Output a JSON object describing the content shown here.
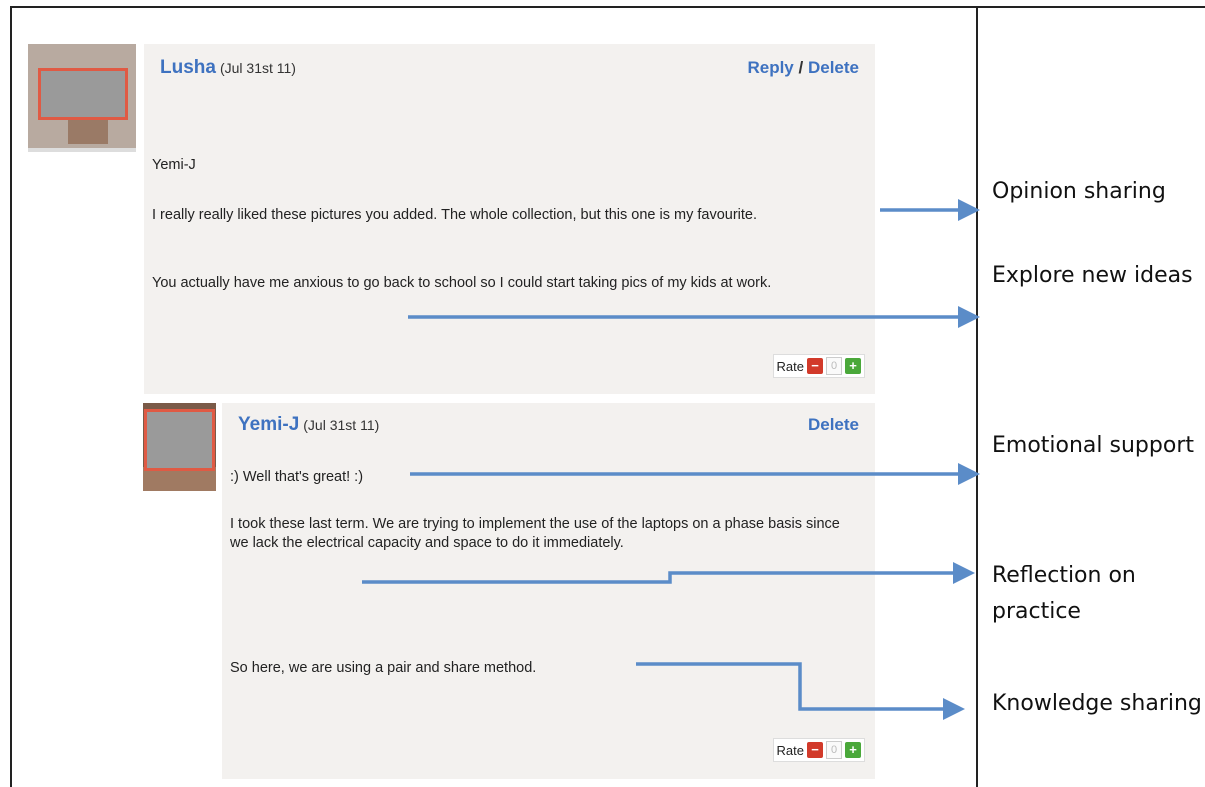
{
  "comments": [
    {
      "author": "Lusha",
      "date": "(Jul 31st 11)",
      "action_reply": "Reply",
      "action_separator": "/",
      "action_delete": "Delete",
      "lines": [
        "Yemi-J",
        "I really really liked these pictures you added. The whole collection, but this one is my favourite.",
        "You actually have me anxious to go back to school so I could start taking pics of my kids at work."
      ],
      "rate_label": "Rate",
      "rate_count": "0"
    },
    {
      "author": "Yemi-J",
      "date": "(Jul 31st 11)",
      "action_delete": "Delete",
      "lines": [
        ":) Well that's great! :)",
        "I took these last term. We are trying to implement the use of the laptops on a phase basis since we lack the electrical capacity and space to do it immediately.",
        "So here, we are using a pair and share method."
      ],
      "rate_label": "Rate",
      "rate_count": "0"
    }
  ],
  "labels": [
    "Opinion sharing",
    "Explore new ideas",
    "Emotional support",
    "Reflection on practice",
    "Knowledge sharing"
  ],
  "colors": {
    "arrow": "#5b8cc8",
    "author": "#3e72c0",
    "panel": "#f3f1ef",
    "redaction_border": "#e05a44"
  }
}
